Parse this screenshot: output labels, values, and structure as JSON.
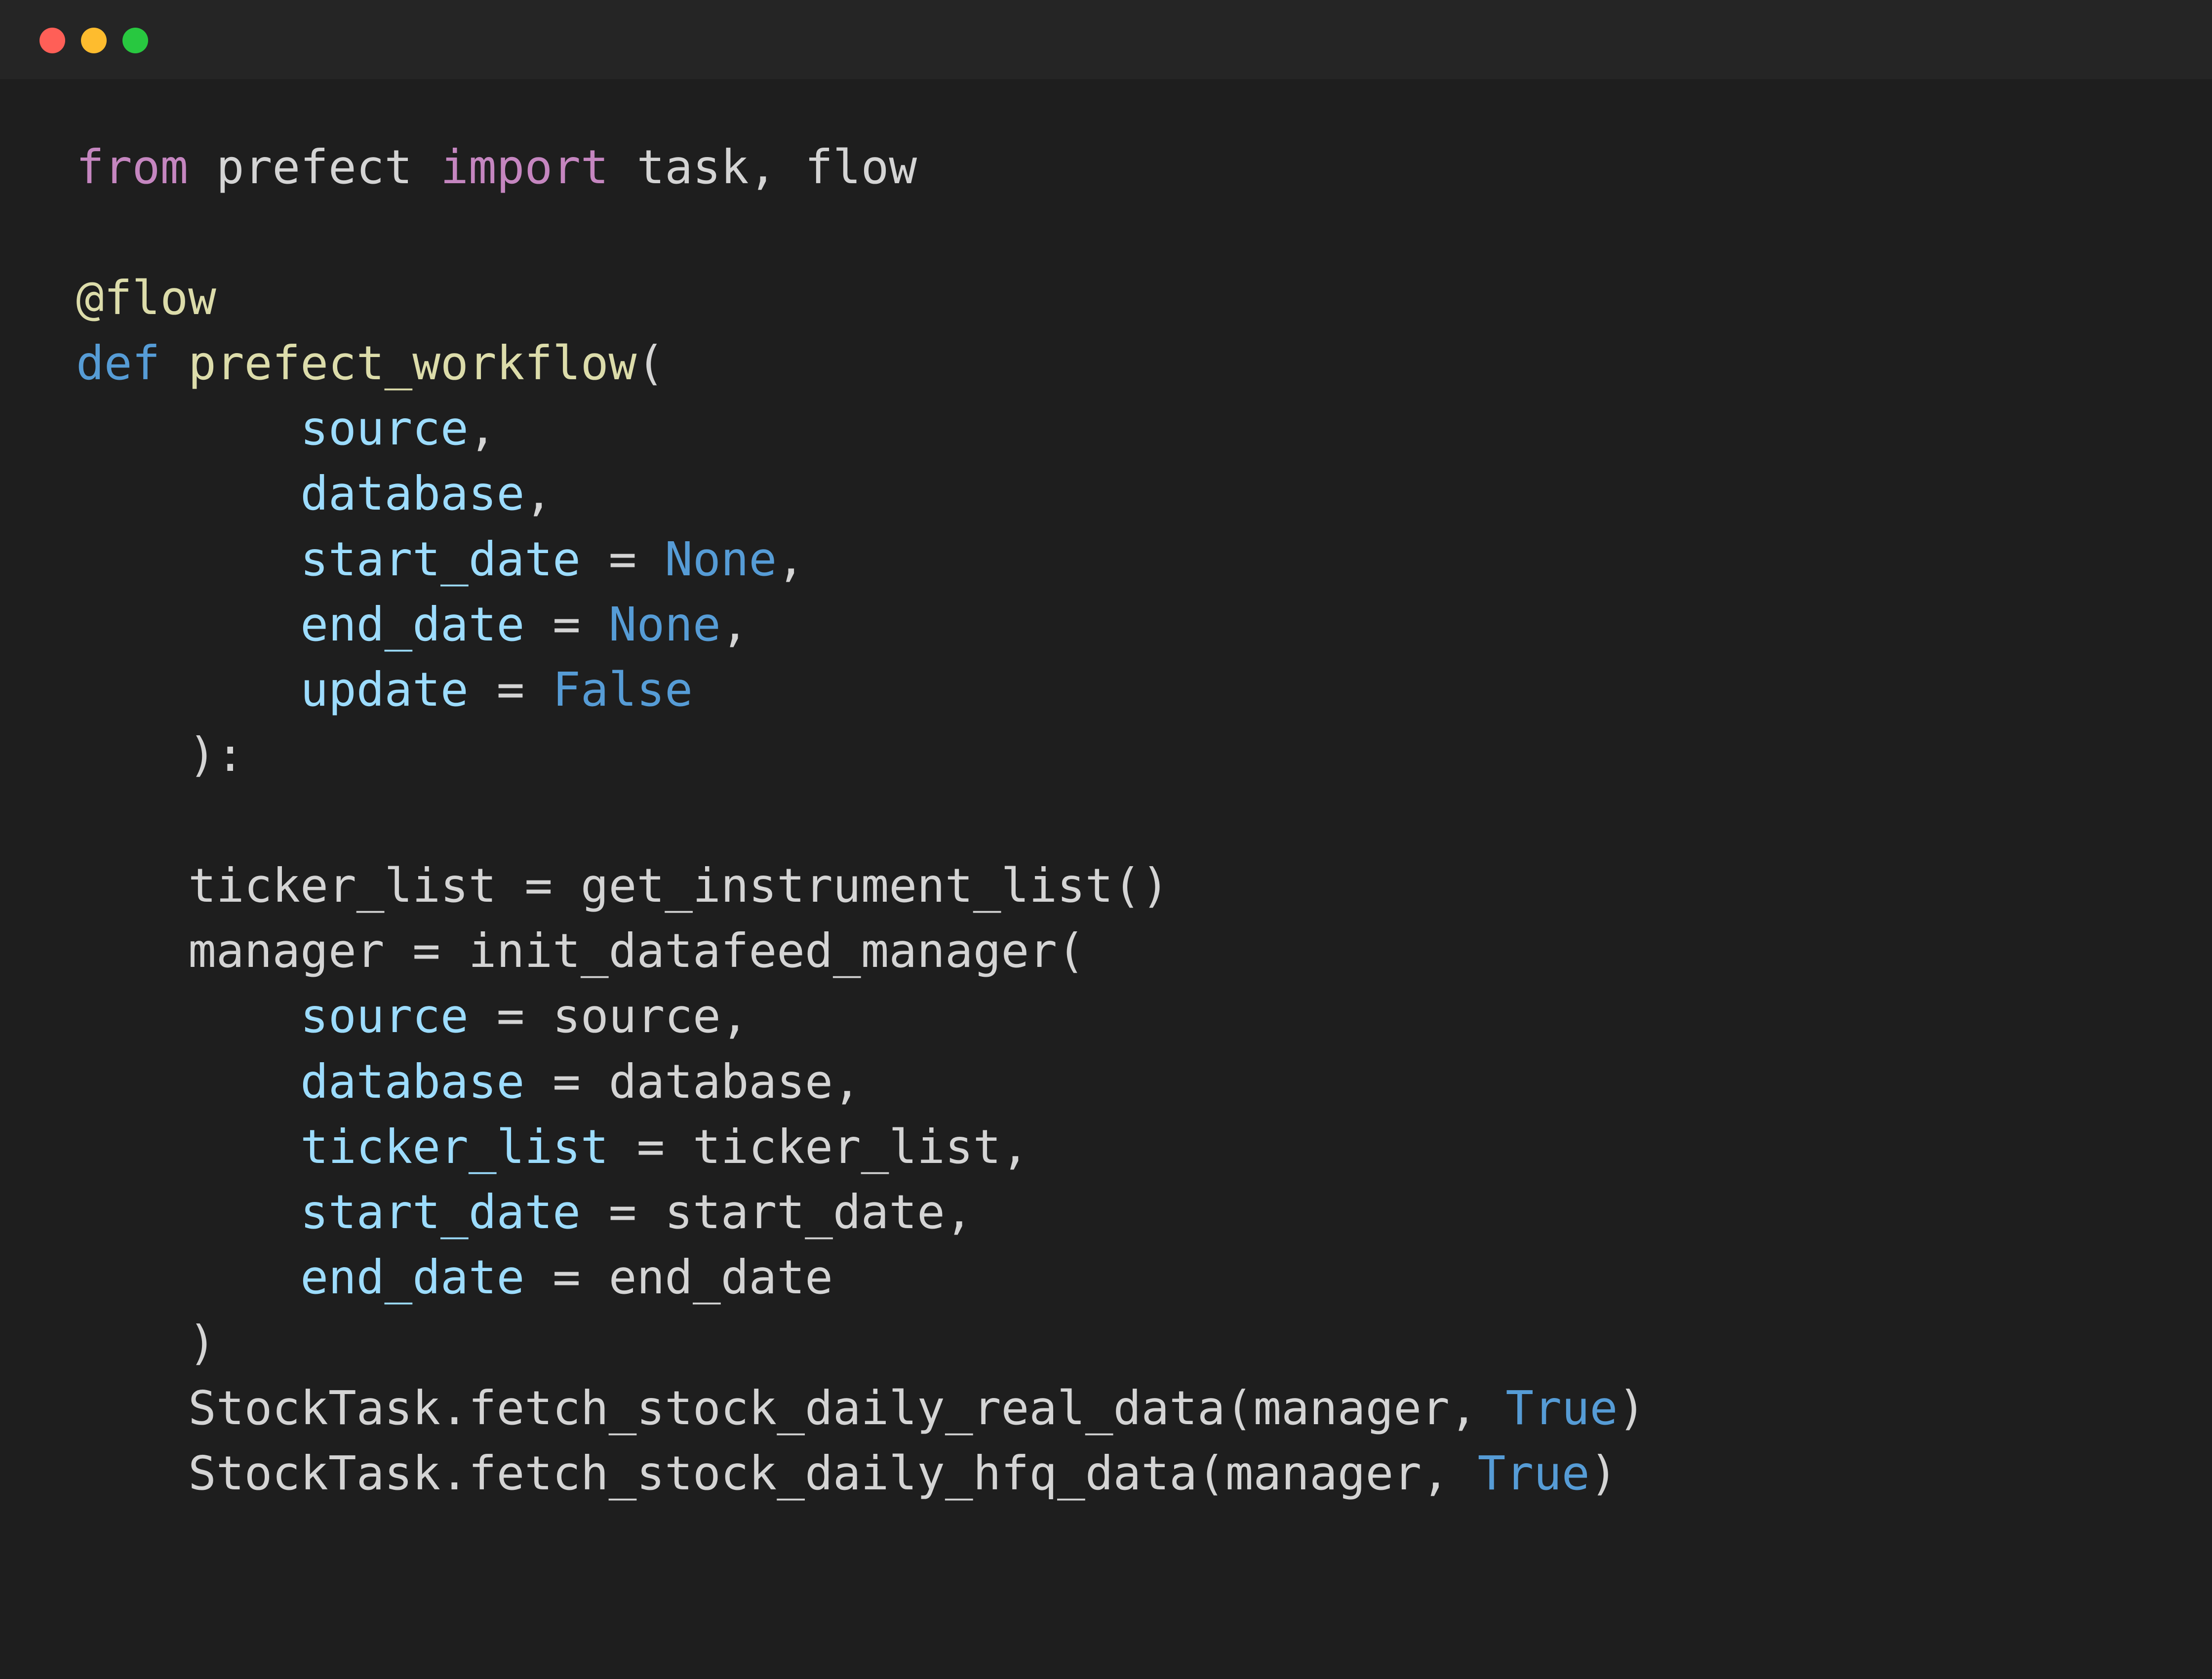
{
  "window": {
    "controls": [
      {
        "name": "close",
        "color": "#FF5F57"
      },
      {
        "name": "minimize",
        "color": "#FEBC2E"
      },
      {
        "name": "maximize",
        "color": "#28C840"
      }
    ]
  },
  "theme": {
    "titlebar_bg": "#252525",
    "editor_bg": "#1E1E1E",
    "plain": "#D4D4D4",
    "keyword": "#C586C0",
    "decorator": "#DCDCAA",
    "def": "#569CD6",
    "function": "#DCDCAA",
    "param": "#9CDCFE",
    "constant": "#569CD6"
  },
  "code": {
    "language": "python",
    "lines": [
      [
        {
          "t": "keyword",
          "v": "from"
        },
        {
          "t": "plain",
          "v": " prefect "
        },
        {
          "t": "keyword",
          "v": "import"
        },
        {
          "t": "plain",
          "v": " task, flow"
        }
      ],
      [],
      [
        {
          "t": "decorator",
          "v": "@flow"
        }
      ],
      [
        {
          "t": "def",
          "v": "def"
        },
        {
          "t": "plain",
          "v": " "
        },
        {
          "t": "function",
          "v": "prefect_workflow"
        },
        {
          "t": "plain",
          "v": "("
        }
      ],
      [
        {
          "t": "plain",
          "v": "        "
        },
        {
          "t": "param",
          "v": "source"
        },
        {
          "t": "plain",
          "v": ","
        }
      ],
      [
        {
          "t": "plain",
          "v": "        "
        },
        {
          "t": "param",
          "v": "database"
        },
        {
          "t": "plain",
          "v": ","
        }
      ],
      [
        {
          "t": "plain",
          "v": "        "
        },
        {
          "t": "param",
          "v": "start_date"
        },
        {
          "t": "plain",
          "v": " = "
        },
        {
          "t": "constant",
          "v": "None"
        },
        {
          "t": "plain",
          "v": ","
        }
      ],
      [
        {
          "t": "plain",
          "v": "        "
        },
        {
          "t": "param",
          "v": "end_date"
        },
        {
          "t": "plain",
          "v": " = "
        },
        {
          "t": "constant",
          "v": "None"
        },
        {
          "t": "plain",
          "v": ","
        }
      ],
      [
        {
          "t": "plain",
          "v": "        "
        },
        {
          "t": "param",
          "v": "update"
        },
        {
          "t": "plain",
          "v": " = "
        },
        {
          "t": "constant",
          "v": "False"
        }
      ],
      [
        {
          "t": "plain",
          "v": "    ):"
        }
      ],
      [],
      [
        {
          "t": "plain",
          "v": "    ticker_list = get_instrument_list()"
        }
      ],
      [
        {
          "t": "plain",
          "v": "    manager = init_datafeed_manager("
        }
      ],
      [
        {
          "t": "plain",
          "v": "        "
        },
        {
          "t": "param",
          "v": "source"
        },
        {
          "t": "plain",
          "v": " = source,"
        }
      ],
      [
        {
          "t": "plain",
          "v": "        "
        },
        {
          "t": "param",
          "v": "database"
        },
        {
          "t": "plain",
          "v": " = database,"
        }
      ],
      [
        {
          "t": "plain",
          "v": "        "
        },
        {
          "t": "param",
          "v": "ticker_list"
        },
        {
          "t": "plain",
          "v": " = ticker_list,"
        }
      ],
      [
        {
          "t": "plain",
          "v": "        "
        },
        {
          "t": "param",
          "v": "start_date"
        },
        {
          "t": "plain",
          "v": " = start_date,"
        }
      ],
      [
        {
          "t": "plain",
          "v": "        "
        },
        {
          "t": "param",
          "v": "end_date"
        },
        {
          "t": "plain",
          "v": " = end_date"
        }
      ],
      [
        {
          "t": "plain",
          "v": "    )"
        }
      ],
      [
        {
          "t": "plain",
          "v": "    StockTask.fetch_stock_daily_real_data(manager, "
        },
        {
          "t": "constant",
          "v": "True"
        },
        {
          "t": "plain",
          "v": ")"
        }
      ],
      [
        {
          "t": "plain",
          "v": "    StockTask.fetch_stock_daily_hfq_data(manager, "
        },
        {
          "t": "constant",
          "v": "True"
        },
        {
          "t": "plain",
          "v": ")"
        }
      ]
    ]
  }
}
